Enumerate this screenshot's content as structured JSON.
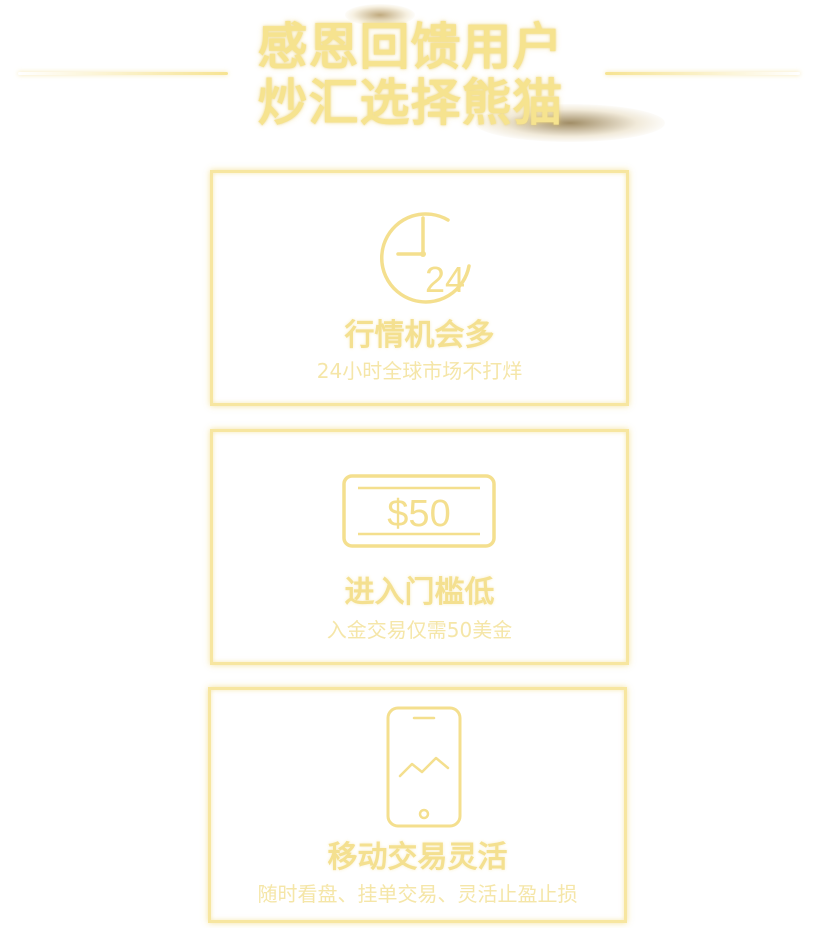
{
  "header": {
    "title_line1": "感恩回馈用户",
    "title_line2": "炒汇选择熊猫"
  },
  "features": [
    {
      "icon": "clock-24-icon",
      "icon_text": "24",
      "title": "行情机会多",
      "subtitle": "24小时全球市场不打烊"
    },
    {
      "icon": "dollar-bill-icon",
      "icon_text": "$50",
      "title": "进入门槛低",
      "subtitle": "入金交易仅需50美金"
    },
    {
      "icon": "mobile-chart-icon",
      "title": "移动交易灵活",
      "subtitle": "随时看盘、挂单交易、灵活止盈止损"
    }
  ],
  "colors": {
    "gold": "#f4df8e",
    "gold_light": "#f7e6a0",
    "background": "#ffffff"
  }
}
